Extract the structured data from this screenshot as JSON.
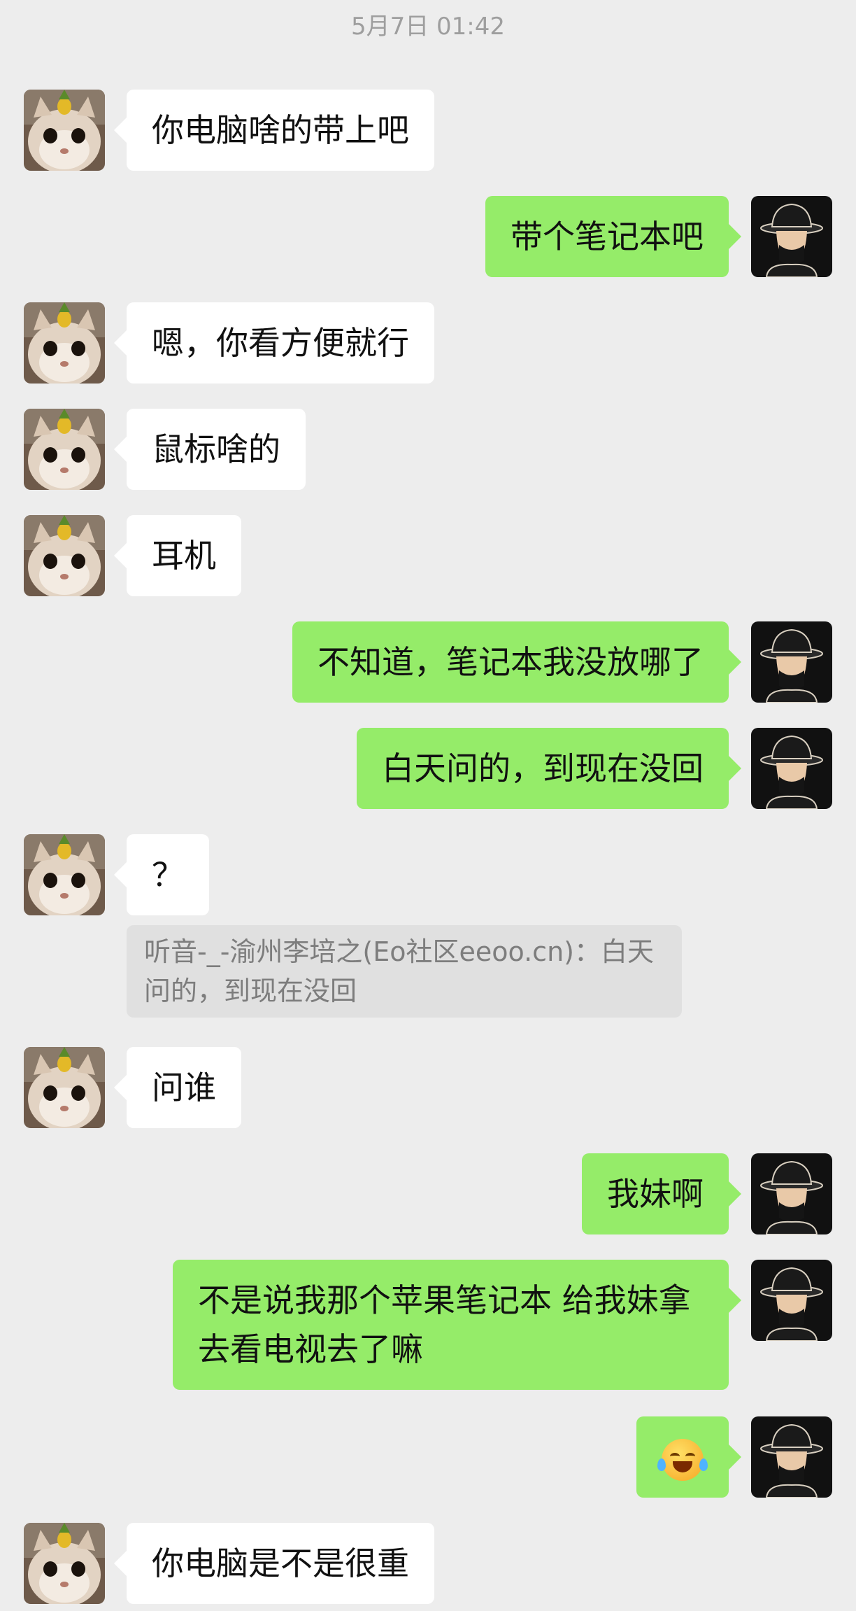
{
  "timestamp": "5月7日 01:42",
  "avatars": {
    "left": "cat-with-pineapple-avatar",
    "right": "man-in-hat-avatar"
  },
  "messages": [
    {
      "side": "left",
      "text": "你电脑啥的带上吧"
    },
    {
      "side": "right",
      "text": "带个笔记本吧"
    },
    {
      "side": "left",
      "text": "嗯，你看方便就行"
    },
    {
      "side": "left",
      "text": "鼠标啥的"
    },
    {
      "side": "left",
      "text": "耳机"
    },
    {
      "side": "right",
      "text": "不知道，笔记本我没放哪了"
    },
    {
      "side": "right",
      "text": "白天问的，到现在没回"
    },
    {
      "side": "left",
      "text": "？",
      "quote": "听音-_-渝州李培之(Eo社区eeoo.cn)：白天问的，到现在没回"
    },
    {
      "side": "left",
      "text": "问谁"
    },
    {
      "side": "right",
      "text": "我妹啊"
    },
    {
      "side": "right",
      "text": "不是说我那个苹果笔记本 给我妹拿去看电视去了嘛"
    },
    {
      "side": "right",
      "text": "",
      "emoji": "rolling-laughing-emoji"
    },
    {
      "side": "left",
      "text": "你电脑是不是很重"
    }
  ]
}
